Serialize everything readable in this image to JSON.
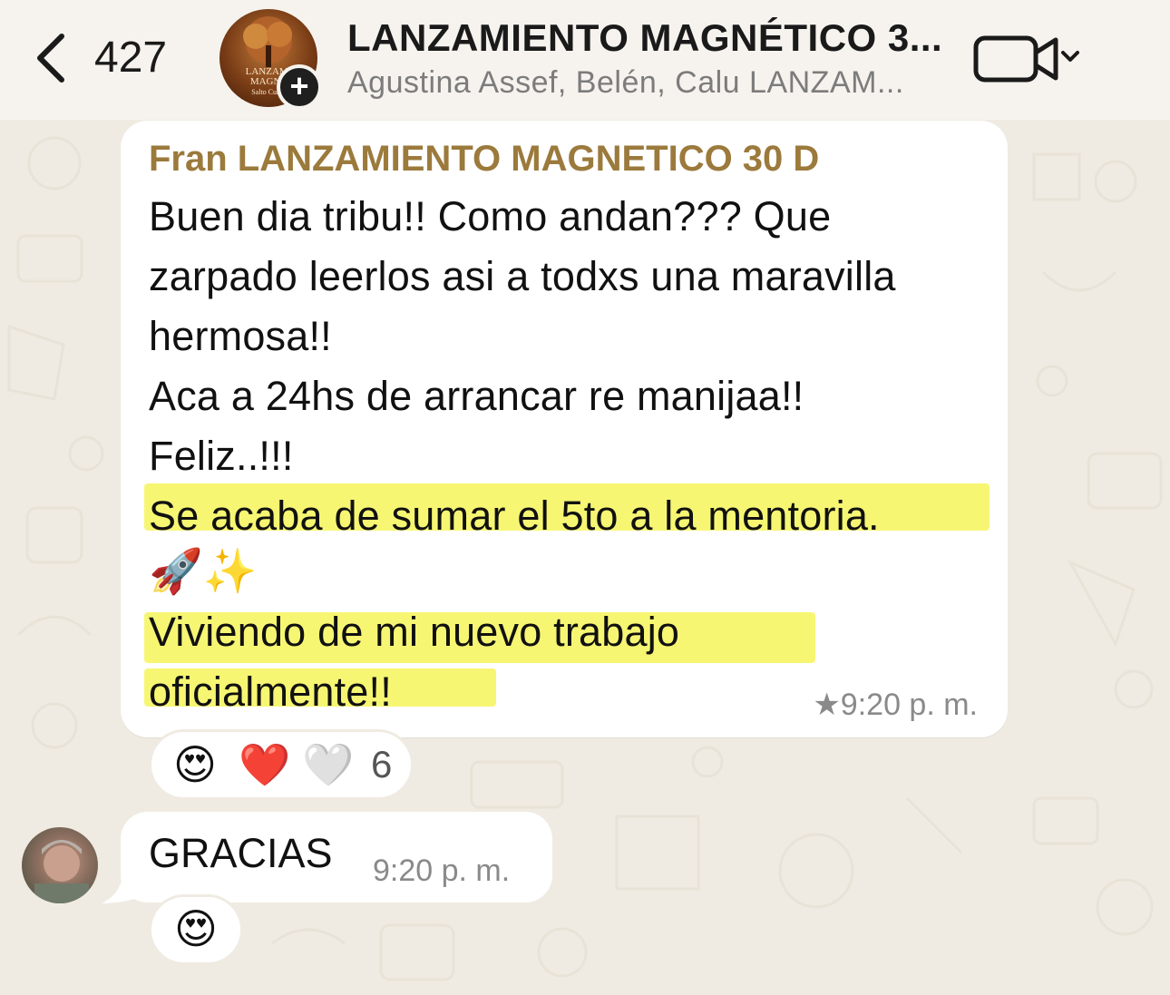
{
  "header": {
    "back_count": "427",
    "title": "LANZAMIENTO MAGNÉTICO 3...",
    "subtitle": "Agustina Assef, Belén, Calu LANZAM...",
    "avatar_text": [
      "LANZAMI",
      "MAGNE",
      "Salto Cuánt"
    ],
    "add_badge": "+"
  },
  "messages": [
    {
      "sender": "Fran LANZAMIENTO MAGNETICO 30 D",
      "lines": [
        "Buen dia tribu!! Como andan??? Que",
        "zarpado leerlos asi a todxs una maravilla",
        "hermosa!!",
        " Aca a 24hs de arrancar re manijaa!!",
        "Feliz..!!!",
        "Se acaba de sumar el 5to a la mentoria.",
        "🚀✨",
        "Viviendo de mi nuevo trabajo",
        "oficialmente!!"
      ],
      "time": "★9:20 p. m.",
      "reactions": [
        "😍",
        "❤️",
        "🤍"
      ],
      "reaction_count": "6"
    },
    {
      "text": "GRACIAS",
      "time": "9:20 p. m.",
      "reaction": "😍"
    }
  ],
  "colors": {
    "background": "#f0ebe2",
    "sender_name": "#9b7a3c",
    "highlight": "#f7f673",
    "bubble": "#ffffff"
  },
  "icons": [
    "chevron-left-icon",
    "video-call-icon",
    "chevron-down-icon",
    "add-icon"
  ]
}
